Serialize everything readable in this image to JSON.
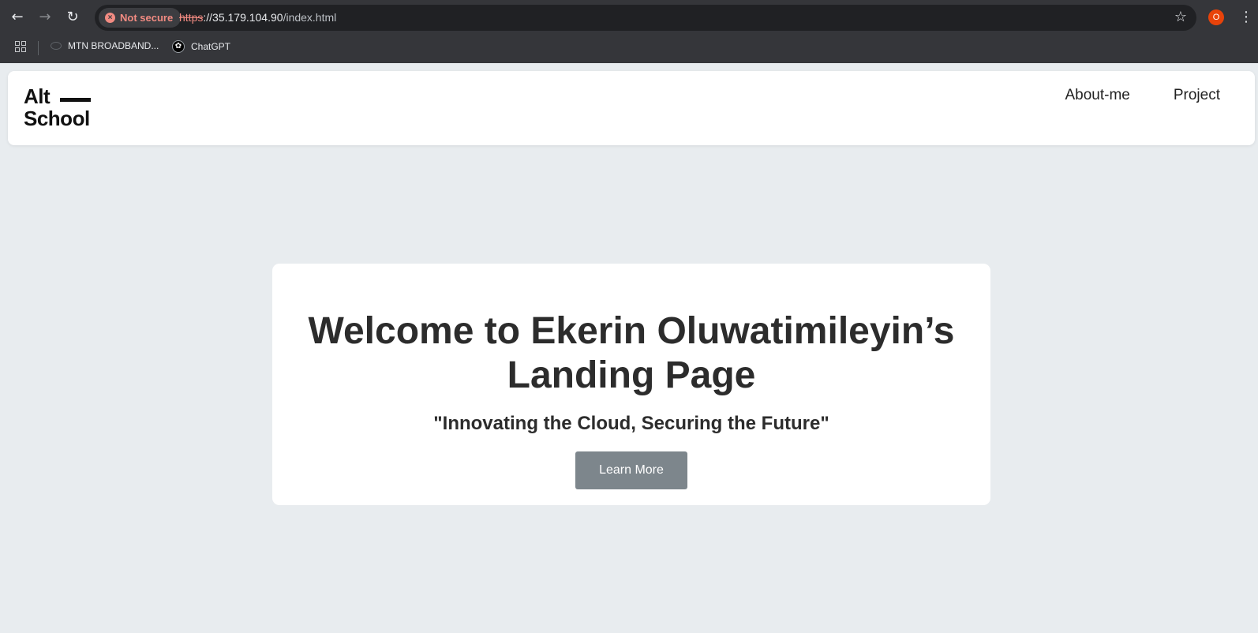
{
  "browser": {
    "security_label": "Not secure",
    "url_scheme": "https",
    "url_rest_host": "://35.179.104.90",
    "url_path": "/index.html",
    "profile_initial": "O",
    "bookmarks": [
      {
        "label": "MTN BROADBAND..."
      },
      {
        "label": "ChatGPT"
      }
    ]
  },
  "site": {
    "logo_line1": "Alt",
    "logo_line2": "School",
    "nav": [
      {
        "label": "About-me"
      },
      {
        "label": "Project"
      }
    ]
  },
  "hero": {
    "title_line1": "Welcome to Ekerin Oluwatimileyin’s",
    "title_line2": "Landing Page",
    "subtitle": "\"Innovating the Cloud, Securing the Future\"",
    "button_label": "Learn More"
  },
  "colors": {
    "page_background": "#e8ecef",
    "button_background": "#7d868c",
    "heading_text": "#2c2c2c"
  }
}
